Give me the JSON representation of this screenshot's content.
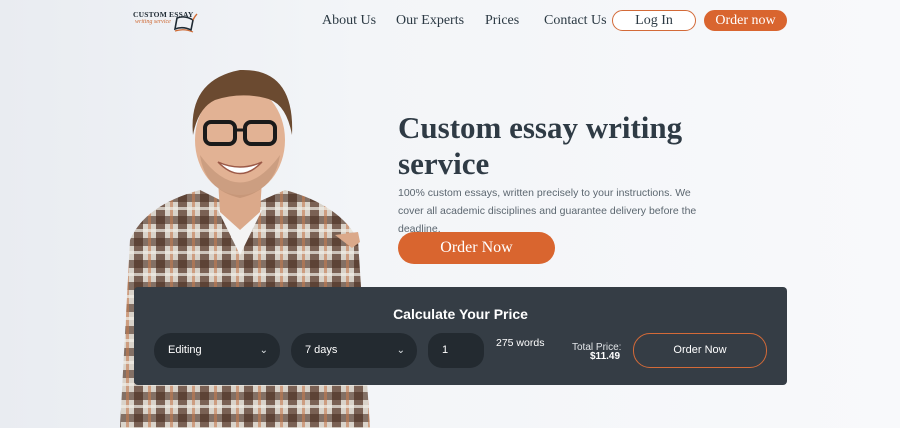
{
  "logo": {
    "title": "CUSTOM ESSAY",
    "subtitle": "writing service"
  },
  "nav": {
    "items": [
      "About Us",
      "Our Experts",
      "Prices",
      "Contact Us"
    ],
    "login": "Log In",
    "order": "Order now"
  },
  "hero": {
    "title": "Custom essay writing service",
    "description": "100% custom essays, written precisely to your instructions. We cover all academic disciplines and guarantee delivery before the deadline.",
    "cta": "Order Now"
  },
  "calculator": {
    "title": "Calculate Your Price",
    "service": "Editing",
    "deadline": "7 days",
    "pages": "1",
    "words": "275 words",
    "total_label": "Total Price:",
    "total_value": "$11.49",
    "order": "Order Now"
  },
  "colors": {
    "accent": "#d9652f",
    "panel": "#353d45",
    "input": "#232a30"
  }
}
